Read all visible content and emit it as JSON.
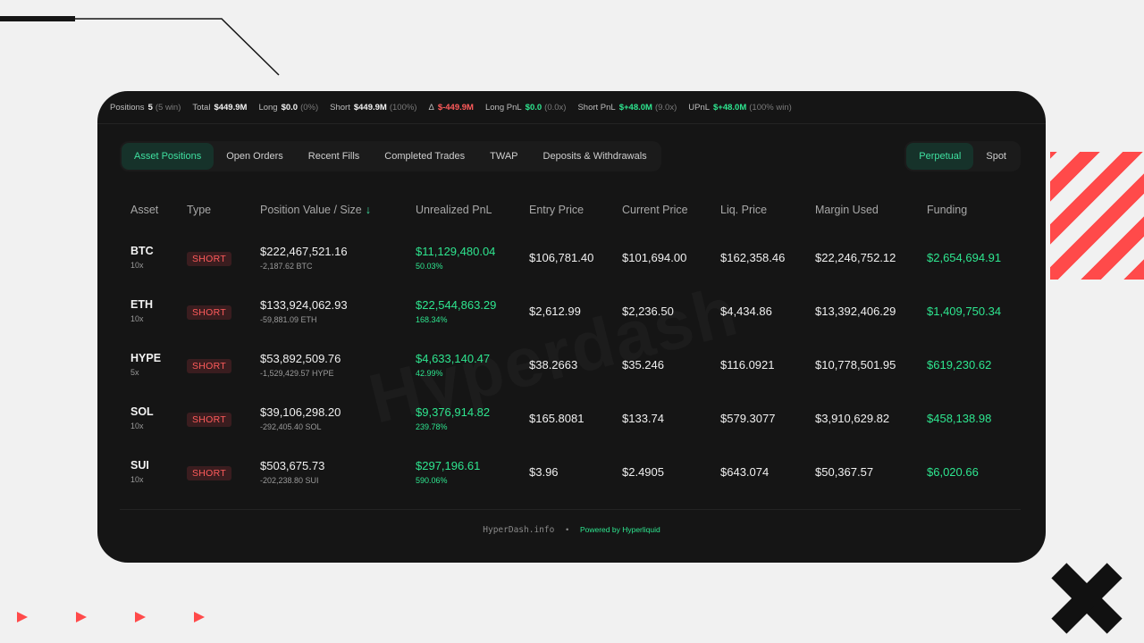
{
  "stats": [
    {
      "label": "Positions",
      "value": "5",
      "sub": "(5 win)",
      "color": ""
    },
    {
      "label": "Total",
      "value": "$449.9M",
      "sub": "",
      "color": ""
    },
    {
      "label": "Long",
      "value": "$0.0",
      "sub": "(0%)",
      "color": ""
    },
    {
      "label": "Short",
      "value": "$449.9M",
      "sub": "(100%)",
      "color": ""
    },
    {
      "label": "Δ",
      "value": "$-449.9M",
      "sub": "",
      "color": "red"
    },
    {
      "label": "Long PnL",
      "value": "$0.0",
      "sub": "(0.0x)",
      "color": "green"
    },
    {
      "label": "Short PnL",
      "value": "$+48.0M",
      "sub": "(9.0x)",
      "color": "green"
    },
    {
      "label": "UPnL",
      "value": "$+48.0M",
      "sub": "(100% win)",
      "color": "green"
    }
  ],
  "tabs": [
    "Asset Positions",
    "Open Orders",
    "Recent Fills",
    "Completed Trades",
    "TWAP",
    "Deposits & Withdrawals"
  ],
  "seg_tabs": [
    "Perpetual",
    "Spot"
  ],
  "columns": {
    "asset": "Asset",
    "type": "Type",
    "position": "Position Value / Size",
    "sort_arrow": "↓",
    "upnl": "Unrealized PnL",
    "entry": "Entry Price",
    "current": "Current Price",
    "liq": "Liq. Price",
    "margin": "Margin Used",
    "funding": "Funding"
  },
  "rows": [
    {
      "asset": "BTC",
      "leverage": "10x",
      "type": "SHORT",
      "value": "$222,467,521.16",
      "size": "-2,187.62 BTC",
      "upnl": "$11,129,480.04",
      "upnl_pct": "50.03%",
      "entry": "$106,781.40",
      "current": "$101,694.00",
      "liq": "$162,358.46",
      "margin": "$22,246,752.12",
      "funding": "$2,654,694.91"
    },
    {
      "asset": "ETH",
      "leverage": "10x",
      "type": "SHORT",
      "value": "$133,924,062.93",
      "size": "-59,881.09 ETH",
      "upnl": "$22,544,863.29",
      "upnl_pct": "168.34%",
      "entry": "$2,612.99",
      "current": "$2,236.50",
      "liq": "$4,434.86",
      "margin": "$13,392,406.29",
      "funding": "$1,409,750.34"
    },
    {
      "asset": "HYPE",
      "leverage": "5x",
      "type": "SHORT",
      "value": "$53,892,509.76",
      "size": "-1,529,429.57 HYPE",
      "upnl": "$4,633,140.47",
      "upnl_pct": "42.99%",
      "entry": "$38.2663",
      "current": "$35.246",
      "liq": "$116.0921",
      "margin": "$10,778,501.95",
      "funding": "$619,230.62"
    },
    {
      "asset": "SOL",
      "leverage": "10x",
      "type": "SHORT",
      "value": "$39,106,298.20",
      "size": "-292,405.40 SOL",
      "upnl": "$9,376,914.82",
      "upnl_pct": "239.78%",
      "entry": "$165.8081",
      "current": "$133.74",
      "liq": "$579.3077",
      "margin": "$3,910,629.82",
      "funding": "$458,138.98"
    },
    {
      "asset": "SUI",
      "leverage": "10x",
      "type": "SHORT",
      "value": "$503,675.73",
      "size": "-202,238.80 SUI",
      "upnl": "$297,196.61",
      "upnl_pct": "590.06%",
      "entry": "$3.96",
      "current": "$2.4905",
      "liq": "$643.074",
      "margin": "$50,367.57",
      "funding": "$6,020.66"
    }
  ],
  "footer": {
    "site": "HyperDash.info",
    "dot": "•",
    "powered": "Powered by Hyperliquid"
  },
  "watermark": "Hyperdash",
  "colors": {
    "accent": "#2ee58f",
    "short": "#ff5b5b",
    "panel": "#151515"
  }
}
